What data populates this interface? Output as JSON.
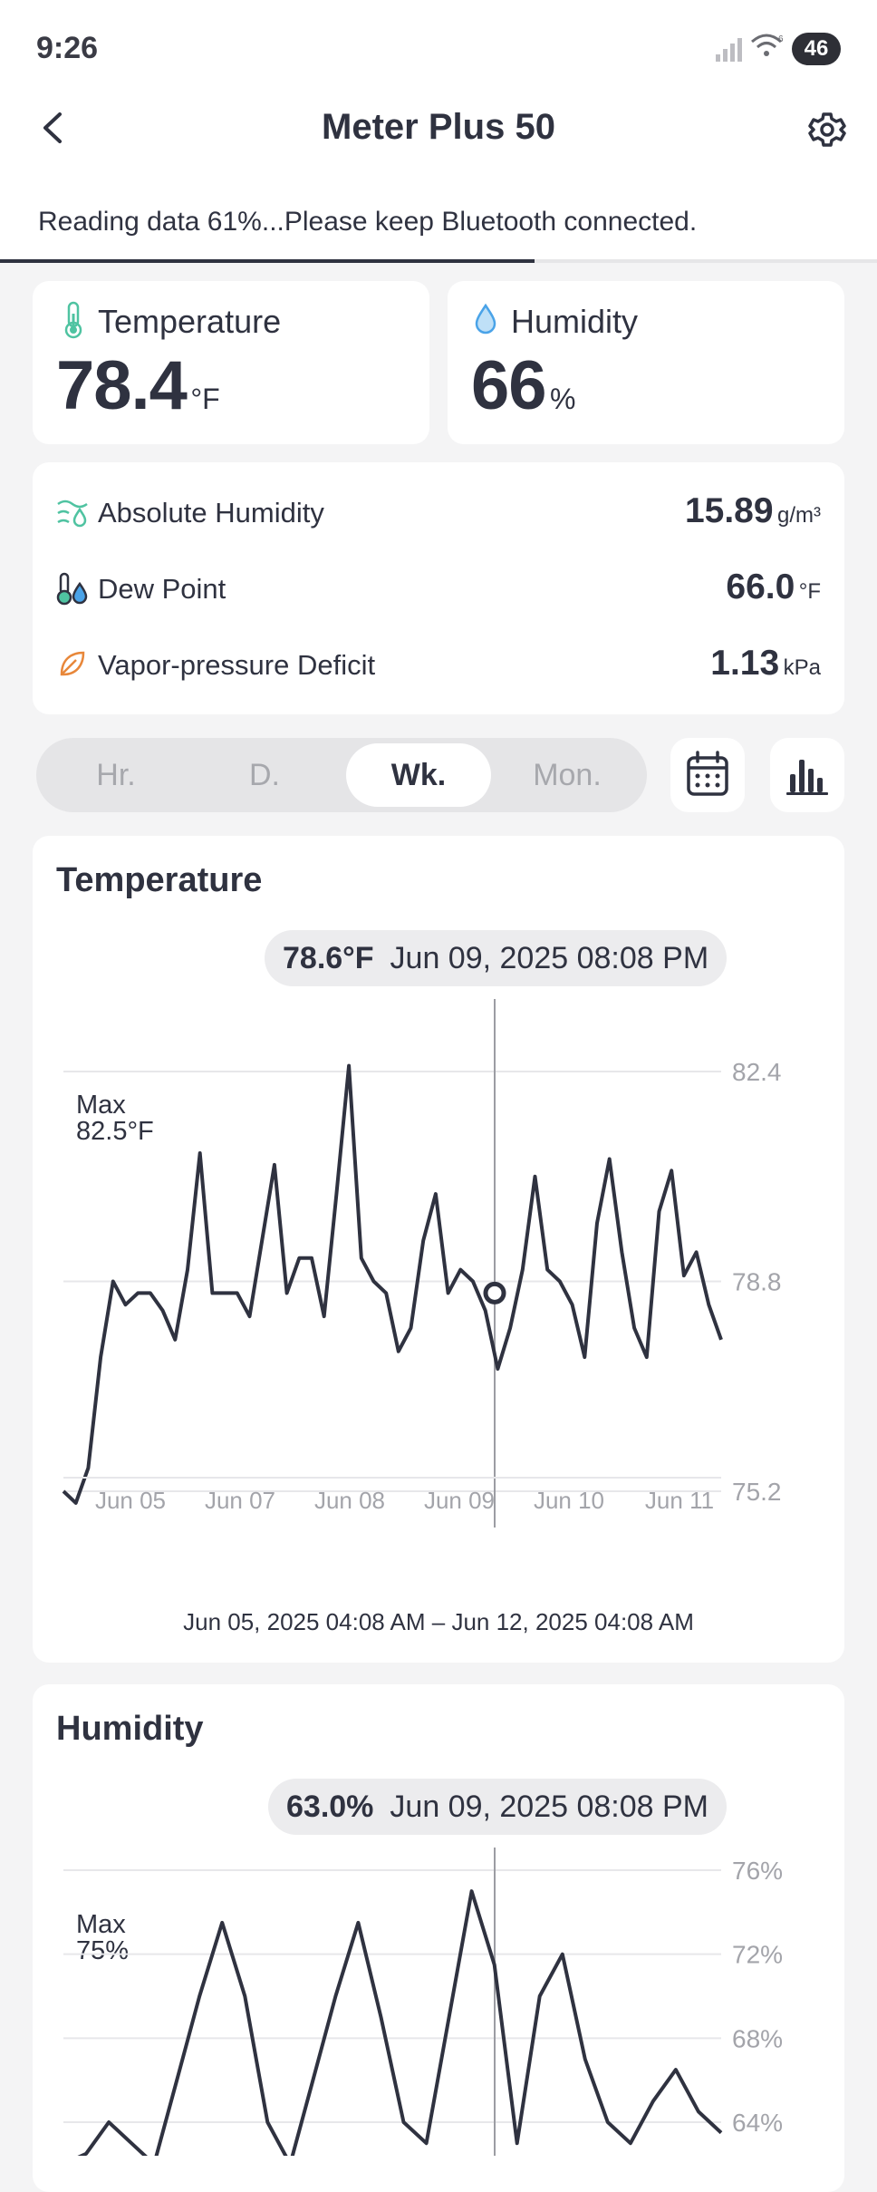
{
  "status_bar": {
    "time": "9:26",
    "battery": "46",
    "wifi_badge": "6"
  },
  "header": {
    "title": "Meter Plus 50"
  },
  "sync": {
    "message": "Reading data 61%...Please keep Bluetooth connected.",
    "progress_percent": 61
  },
  "current": {
    "temperature": {
      "label": "Temperature",
      "value": "78.4",
      "unit": "°F"
    },
    "humidity": {
      "label": "Humidity",
      "value": "66",
      "unit": "%"
    }
  },
  "metrics": [
    {
      "label": "Absolute Humidity",
      "value": "15.89",
      "unit": "g/m³",
      "icon": "absolute-humidity-icon"
    },
    {
      "label": "Dew Point",
      "value": "66.0",
      "unit": "°F",
      "icon": "dew-point-icon"
    },
    {
      "label": "Vapor-pressure Deficit",
      "value": "1.13",
      "unit": "kPa",
      "icon": "leaf-icon"
    }
  ],
  "range_tabs": [
    "Hr.",
    "D.",
    "Wk.",
    "Mon."
  ],
  "selected_tab": "Wk.",
  "colors": {
    "accent": "#2f3240",
    "temp_icon": "#4fc3a1",
    "humidity_icon": "#4aa3e8",
    "vpd_icon": "#e8873a"
  },
  "temperature_chart": {
    "title": "Temperature",
    "tooltip_value": "78.6°F",
    "tooltip_date": "Jun 09, 2025 08:08 PM",
    "max_label": "Max",
    "max_value": "82.5°F",
    "range_text": "Jun 05, 2025 04:08 AM – Jun 12, 2025 04:08 AM"
  },
  "humidity_chart": {
    "title": "Humidity",
    "tooltip_value": "63.0%",
    "tooltip_date": "Jun 09, 2025 08:08 PM",
    "max_label": "Max",
    "max_value": "75%"
  },
  "chart_data": [
    {
      "type": "line",
      "title": "Temperature",
      "x_ticks": [
        "Jun 05",
        "Jun 07",
        "Jun 08",
        "Jun 09",
        "Jun 10",
        "Jun 11"
      ],
      "y_ticks": [
        "82.4",
        "78.8",
        "75.2"
      ],
      "ylim": [
        75.2,
        82.4
      ],
      "grid": true,
      "series": [
        {
          "values": [
            75.2,
            75.0,
            75.6,
            77.5,
            78.8,
            78.4,
            78.6,
            78.6,
            78.3,
            77.8,
            79.0,
            81.0,
            78.6,
            78.6,
            78.6,
            78.2,
            79.5,
            80.8,
            78.6,
            79.2,
            79.2,
            78.2,
            80.3,
            82.5,
            79.2,
            78.8,
            78.6,
            77.6,
            78.0,
            79.5,
            80.3,
            78.6,
            79.0,
            78.8,
            78.3,
            77.3,
            78.0,
            79.0,
            80.6,
            79.0,
            78.8,
            78.4,
            77.5,
            79.8,
            80.9,
            79.3,
            78.0,
            77.5,
            80.0,
            80.7,
            78.9,
            79.3,
            78.4,
            77.8
          ],
          "highlight_index": 34,
          "highlight_value": 78.6
        }
      ]
    },
    {
      "type": "line",
      "title": "Humidity",
      "y_ticks": [
        "76%",
        "72%",
        "68%",
        "64%"
      ],
      "ylim": [
        64,
        76
      ],
      "grid": true,
      "series": [
        {
          "values": [
            62.0,
            62.5,
            64.0,
            63.0,
            62.0,
            66.0,
            70.0,
            73.5,
            70.0,
            64.0,
            62.0,
            66.0,
            70.0,
            73.5,
            69.0,
            64.0,
            63.0,
            69.0,
            75.0,
            71.5,
            63.0,
            70.0,
            72.0,
            67.0,
            64.0,
            63.0,
            65.0,
            66.5,
            64.5,
            63.5
          ],
          "highlight_value": 63.0
        }
      ]
    }
  ]
}
